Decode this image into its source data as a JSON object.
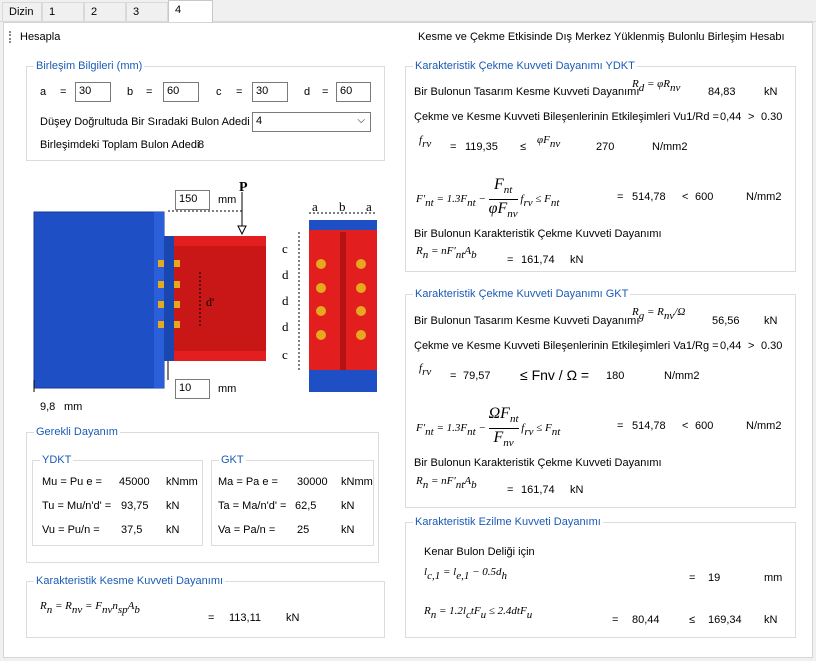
{
  "tabs": {
    "t0": "Dizin",
    "t1": "1",
    "t2": "2",
    "t3": "3",
    "t4": "4"
  },
  "toolbar": {
    "title": "Hesapla",
    "header": "Kesme ve Çekme Etkisinde Dış Merkez Yüklenmiş Bulonlu Birleşim Hesabı"
  },
  "connection": {
    "title": "Birleşim Bilgileri (mm)",
    "a_label": "a",
    "a_eq": "=",
    "a_value": "30",
    "b_label": "b",
    "b_eq": "=",
    "b_value": "60",
    "c_label": "c",
    "c_eq": "=",
    "c_value": "30",
    "d_label": "d",
    "d_eq": "=",
    "d_value": "60",
    "rowbolt_label": "Düşey Doğrultuda Bir Sıradaki Bulon Adedi",
    "rowbolt_value": "4",
    "total_label": "Birleşimdeki Toplam Bulon Adedi",
    "total_value": "8"
  },
  "drawing": {
    "ecc_value": "150",
    "ecc_unit": "mm",
    "load_label": "P",
    "dprime": "d'",
    "gap_value": "10",
    "gap_unit": "mm",
    "thick_value": "9,8",
    "thick_unit": "mm",
    "top_a1": "a",
    "top_b": "b",
    "top_a2": "a",
    "side_c1": "c",
    "side_d1": "d",
    "side_d2": "d",
    "side_d3": "d",
    "side_c2": "c"
  },
  "required": {
    "title": "Gerekli Dayanım",
    "ydkt_title": "YDKT",
    "r1_label": "Mu = Pu e =",
    "r1_value": "45000",
    "r1_unit": "kNmm",
    "r2_label": "Tu  = Mu/n'd' =",
    "r2_value": "93,75",
    "r2_unit": "kN",
    "r3_label": "Vu  = Pu/n =",
    "r3_value": "37,5",
    "r3_unit": "kN",
    "gkt_title": "GKT",
    "g1_label": "Ma = Pa e =",
    "g1_value": "30000",
    "g1_unit": "kNmm",
    "g2_label": "Ta  = Ma/n'd' =",
    "g2_value": "62,5",
    "g2_unit": "kN",
    "g3_label": "Va  = Pa/n =",
    "g3_value": "25",
    "g3_unit": "kN"
  },
  "shear": {
    "title": "Karakteristik Kesme Kuvveti Dayanımı",
    "eq": "=",
    "value": "113,11",
    "unit": "kN"
  },
  "tension_ydkt": {
    "title": "Karakteristik Çekme Kuvveti Dayanımı YDKT",
    "design_label": "Bir Bulonun Tasarım Kesme Kuvveti Dayanımı",
    "design_value": "84,83",
    "design_unit": "kN",
    "inter_label": "Çekme ve Kesme Kuvveti Bileşenlerinin Etkileşimleri Vu1/Rd =",
    "inter_value": "0,44",
    "inter_op": ">",
    "inter_limit": "0.30",
    "frv_eq": "=",
    "frv_value": "119,35",
    "frv_op": "≤",
    "frv_limit": "270",
    "frv_unit": "N/mm2",
    "fnt_eq": "=",
    "fnt_value": "514,78",
    "fnt_op": "<",
    "fnt_limit": "600",
    "fnt_unit": "N/mm2",
    "char_label": "Bir Bulonun Karakteristik Çekme Kuvveti Dayanımı",
    "rn_eq": "=",
    "rn_value": "161,74",
    "rn_unit": "kN"
  },
  "tension_gkt": {
    "title": "Karakteristik Çekme Kuvveti Dayanımı GKT",
    "design_label": "Bir Bulonun Tasarım Kesme Kuvveti Dayanımı",
    "design_value": "56,56",
    "design_unit": "kN",
    "inter_label": "Çekme ve Kesme Kuvveti Bileşenlerinin Etkileşimleri Va1/Rg =",
    "inter_value": "0,44",
    "inter_op": ">",
    "inter_limit": "0.30",
    "frv_eq": "=",
    "frv_value": "79,57",
    "frv_op": "≤ Fnv / Ω =",
    "frv_limit": "180",
    "frv_unit": "N/mm2",
    "fnt_eq": "=",
    "fnt_value": "514,78",
    "fnt_op": "<",
    "fnt_limit": "600",
    "fnt_unit": "N/mm2",
    "char_label": "Bir Bulonun Karakteristik Çekme Kuvveti Dayanımı",
    "rn_eq": "=",
    "rn_value": "161,74",
    "rn_unit": "kN"
  },
  "bearing": {
    "title": "Karakteristik Ezilme Kuvveti Dayanımı",
    "edge_label": "Kenar Bulon Deliği için",
    "lc_eq": "=",
    "lc_value": "19",
    "lc_unit": "mm",
    "rn_eq": "=",
    "rn_value": "80,44",
    "rn_op": "≤",
    "rn_limit": "169,34",
    "rn_unit": "kN"
  },
  "colors": {
    "accent": "#1a5bb5",
    "column": "#1f4fc4",
    "beam": "#e31e1e",
    "bolt": "#e6a81e"
  }
}
